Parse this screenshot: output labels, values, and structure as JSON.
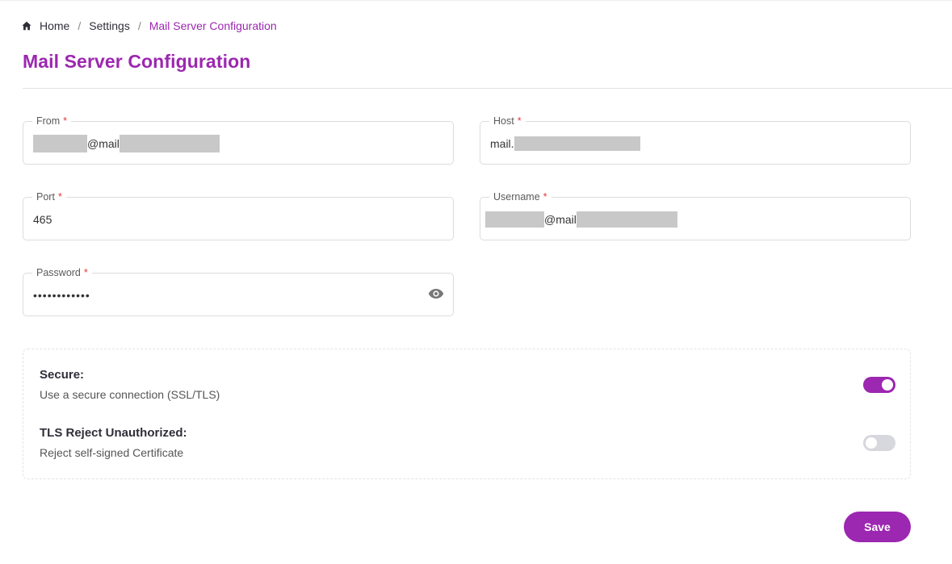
{
  "breadcrumb": {
    "home_icon": "home-icon",
    "items": [
      "Home",
      "Settings",
      "Mail Server Configuration"
    ],
    "separator": "/"
  },
  "page_title": "Mail Server Configuration",
  "form": {
    "from": {
      "label": "From",
      "required_mark": "*",
      "value_visible": "@mail",
      "redacted": true
    },
    "host": {
      "label": "Host",
      "required_mark": "*",
      "value_visible": "mail.",
      "redacted": true
    },
    "port": {
      "label": "Port",
      "required_mark": "*",
      "value": "465"
    },
    "username": {
      "label": "Username",
      "required_mark": "*",
      "value_visible": "@mail",
      "redacted": true
    },
    "password": {
      "label": "Password",
      "required_mark": "*",
      "value_masked": "••••••••••••",
      "visibility_icon": "eye-icon"
    }
  },
  "toggles": {
    "secure": {
      "title": "Secure:",
      "description": "Use a secure connection (SSL/TLS)",
      "on": true
    },
    "tls": {
      "title": "TLS Reject Unauthorized:",
      "description": "Reject self-signed Certificate",
      "on": false
    }
  },
  "actions": {
    "save_label": "Save"
  },
  "colors": {
    "accent": "#9c27b0",
    "required": "#e53935",
    "toggle_off": "#d7d7de",
    "redaction": "#c8c8c8"
  }
}
